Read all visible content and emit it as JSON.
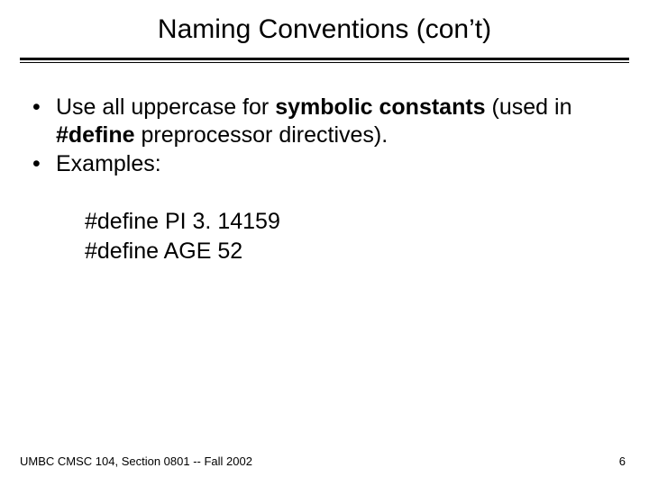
{
  "title": "Naming Conventions (con’t)",
  "bullets": [
    {
      "pre": "Use all uppercase for ",
      "bold1": "symbolic constants",
      "mid": " (used in ",
      "bold2": "#define",
      "post": " preprocessor directives)."
    },
    {
      "text": "Examples:"
    }
  ],
  "examples": [
    "#define PI 3. 14159",
    "#define AGE  52"
  ],
  "footer": "UMBC CMSC 104, Section 0801 -- Fall 2002",
  "page": "6",
  "dot": "•"
}
